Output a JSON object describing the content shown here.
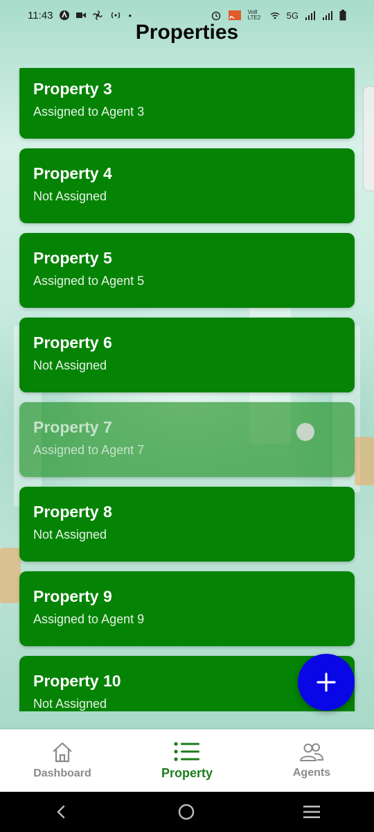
{
  "status_bar": {
    "time": "11:43",
    "network": "5G",
    "carrier_label": "Vo8 LTE2"
  },
  "page": {
    "title": "Properties"
  },
  "properties": [
    {
      "title": "Property 3",
      "subtitle": "Assigned to Agent 3"
    },
    {
      "title": "Property 4",
      "subtitle": "Not Assigned"
    },
    {
      "title": "Property 5",
      "subtitle": "Assigned to Agent 5"
    },
    {
      "title": "Property 6",
      "subtitle": "Not Assigned"
    },
    {
      "title": "Property 7",
      "subtitle": "Assigned to Agent 7"
    },
    {
      "title": "Property 8",
      "subtitle": "Not Assigned"
    },
    {
      "title": "Property 9",
      "subtitle": "Assigned to Agent 9"
    },
    {
      "title": "Property 10",
      "subtitle": "Not Assigned"
    }
  ],
  "fab": {
    "icon": "plus-icon"
  },
  "bottom_nav": {
    "items": [
      {
        "label": "Dashboard",
        "icon": "home-icon",
        "active": false
      },
      {
        "label": "Property",
        "icon": "list-icon",
        "active": true
      },
      {
        "label": "Agents",
        "icon": "people-icon",
        "active": false
      }
    ]
  },
  "colors": {
    "card": "#058305",
    "fab": "#0a07e6",
    "active_nav": "#1b7d1b",
    "inactive_nav": "#8a8a8a"
  }
}
